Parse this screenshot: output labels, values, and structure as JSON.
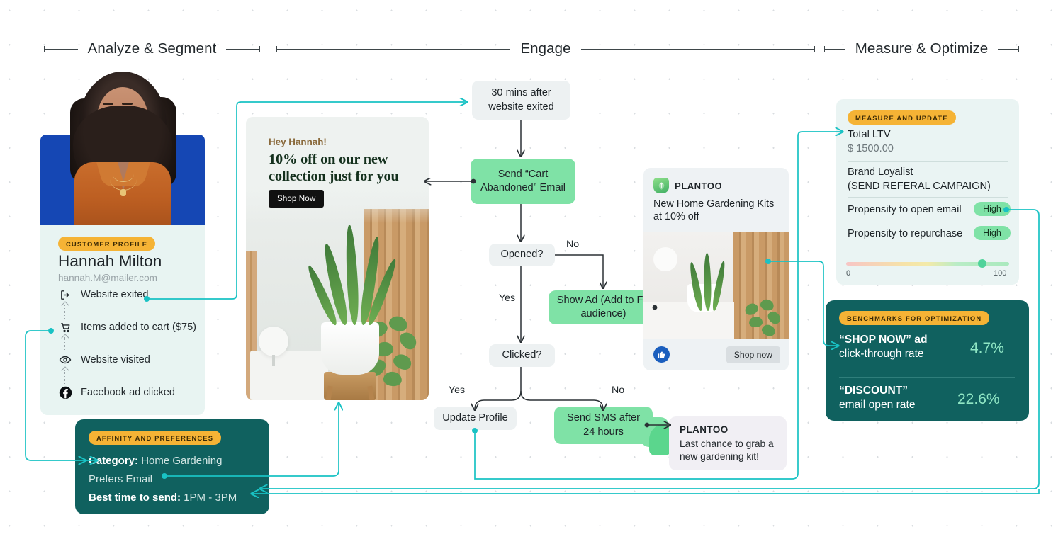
{
  "phases": [
    {
      "label": "Analyze & Segment"
    },
    {
      "label": "Engage"
    },
    {
      "label": "Measure & Optimize"
    }
  ],
  "profile": {
    "badge": "CUSTOMER PROFILE",
    "name": "Hannah Milton",
    "email": "hannah.M@mailer.com",
    "timeline": [
      {
        "icon": "exit-icon",
        "label": "Website exited"
      },
      {
        "icon": "cart-icon",
        "label": "Items added to cart ($75)"
      },
      {
        "icon": "eye-icon",
        "label": "Website visited"
      },
      {
        "icon": "facebook-icon",
        "label": "Facebook ad clicked"
      }
    ]
  },
  "affinity": {
    "badge": "AFFINITY AND PREFERENCES",
    "category_label": "Category:",
    "category_value": "Home Gardening",
    "prefers": "Prefers Email",
    "best_time_label": "Best time to send:",
    "best_time_value": "1PM - 3PM"
  },
  "email_creative": {
    "greeting": "Hey Hannah!",
    "headline": "10% off on our new collection just for you",
    "cta": "Shop Now"
  },
  "flow": {
    "trigger": "30 mins after website exited",
    "send_email": "Send “Cart Abandoned” Email",
    "opened": "Opened?",
    "show_ad": "Show Ad (Add to FB audience)",
    "clicked": "Clicked?",
    "update_profile": "Update Profile",
    "send_sms": "Send SMS after 24 hours",
    "labels": {
      "no1": "No",
      "yes1": "Yes",
      "yes2": "Yes",
      "no2": "No"
    }
  },
  "fb_ad": {
    "brand": "PLANTOO",
    "copy": "New Home Gardening Kits at 10% off",
    "cta": "Shop now",
    "like_icon": "thumbs-up-icon",
    "logo_icon": "leaf-shield-icon"
  },
  "sms": {
    "brand": "PLANTOO",
    "text": "Last chance to grab a new gardening kit!"
  },
  "measure": {
    "badge": "MEASURE AND UPDATE",
    "ltv_label": "Total LTV",
    "ltv_value": "$ 1500.00",
    "segment_line1": "Brand Loyalist",
    "segment_line2": "(SEND REFERAL CAMPAIGN)",
    "propensity_open_label": "Propensity to open email",
    "propensity_open_value": "High",
    "propensity_repurchase_label": "Propensity to repurchase",
    "propensity_repurchase_value": "High",
    "scale_min": "0",
    "scale_max": "100"
  },
  "benchmarks": {
    "badge": "BENCHMARKS FOR OPTIMIZATION",
    "items": [
      {
        "name": "“SHOP NOW” ad",
        "metric": "click-through rate",
        "value": "4.7%"
      },
      {
        "name": "“DISCOUNT”",
        "metric": "email open rate",
        "value": "22.6%"
      }
    ]
  },
  "colors": {
    "teal_card": "#10615f",
    "amber_pill": "#f5b335",
    "green_node": "#7fe2a6",
    "connector": "#19c2c4",
    "portrait_bg": "#1547b4"
  }
}
